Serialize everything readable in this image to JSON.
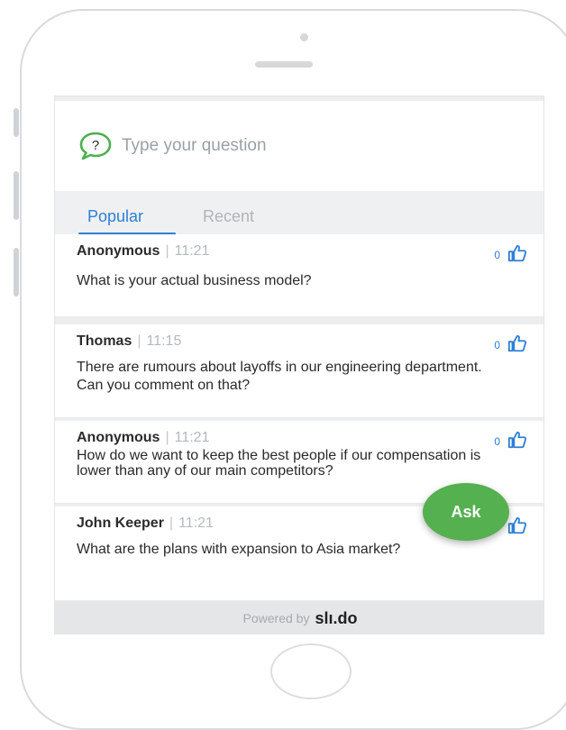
{
  "question_input": {
    "placeholder": "Type your question"
  },
  "tabs": [
    {
      "label": "Popular",
      "active": true
    },
    {
      "label": "Recent",
      "active": false
    }
  ],
  "questions": [
    {
      "author": "Anonymous",
      "time": "11:21",
      "text": "What is your actual business model?",
      "votes": "0"
    },
    {
      "author": "Thomas",
      "time": "11:15",
      "text": "There are rumours about layoffs in our engineering department. Can you comment on that?",
      "votes": "0"
    },
    {
      "author": "Anonymous",
      "time": "11:21",
      "text": "How do we want to keep the best people if our compensation is lower than any of our main competitors?",
      "votes": "0"
    },
    {
      "author": "John Keeper",
      "time": "11:21",
      "text": "What are the plans with expansion to Asia market?",
      "votes": ""
    }
  ],
  "ask_button": {
    "label": "Ask"
  },
  "footer": {
    "powered_by": "Powered by",
    "brand": "slı.do"
  },
  "colors": {
    "accent": "#2f7fd6",
    "ask_green": "#55b04f",
    "icon_green": "#4caf50"
  },
  "icons": {
    "question": "question-bubble-icon",
    "vote": "thumbs-up-icon"
  }
}
